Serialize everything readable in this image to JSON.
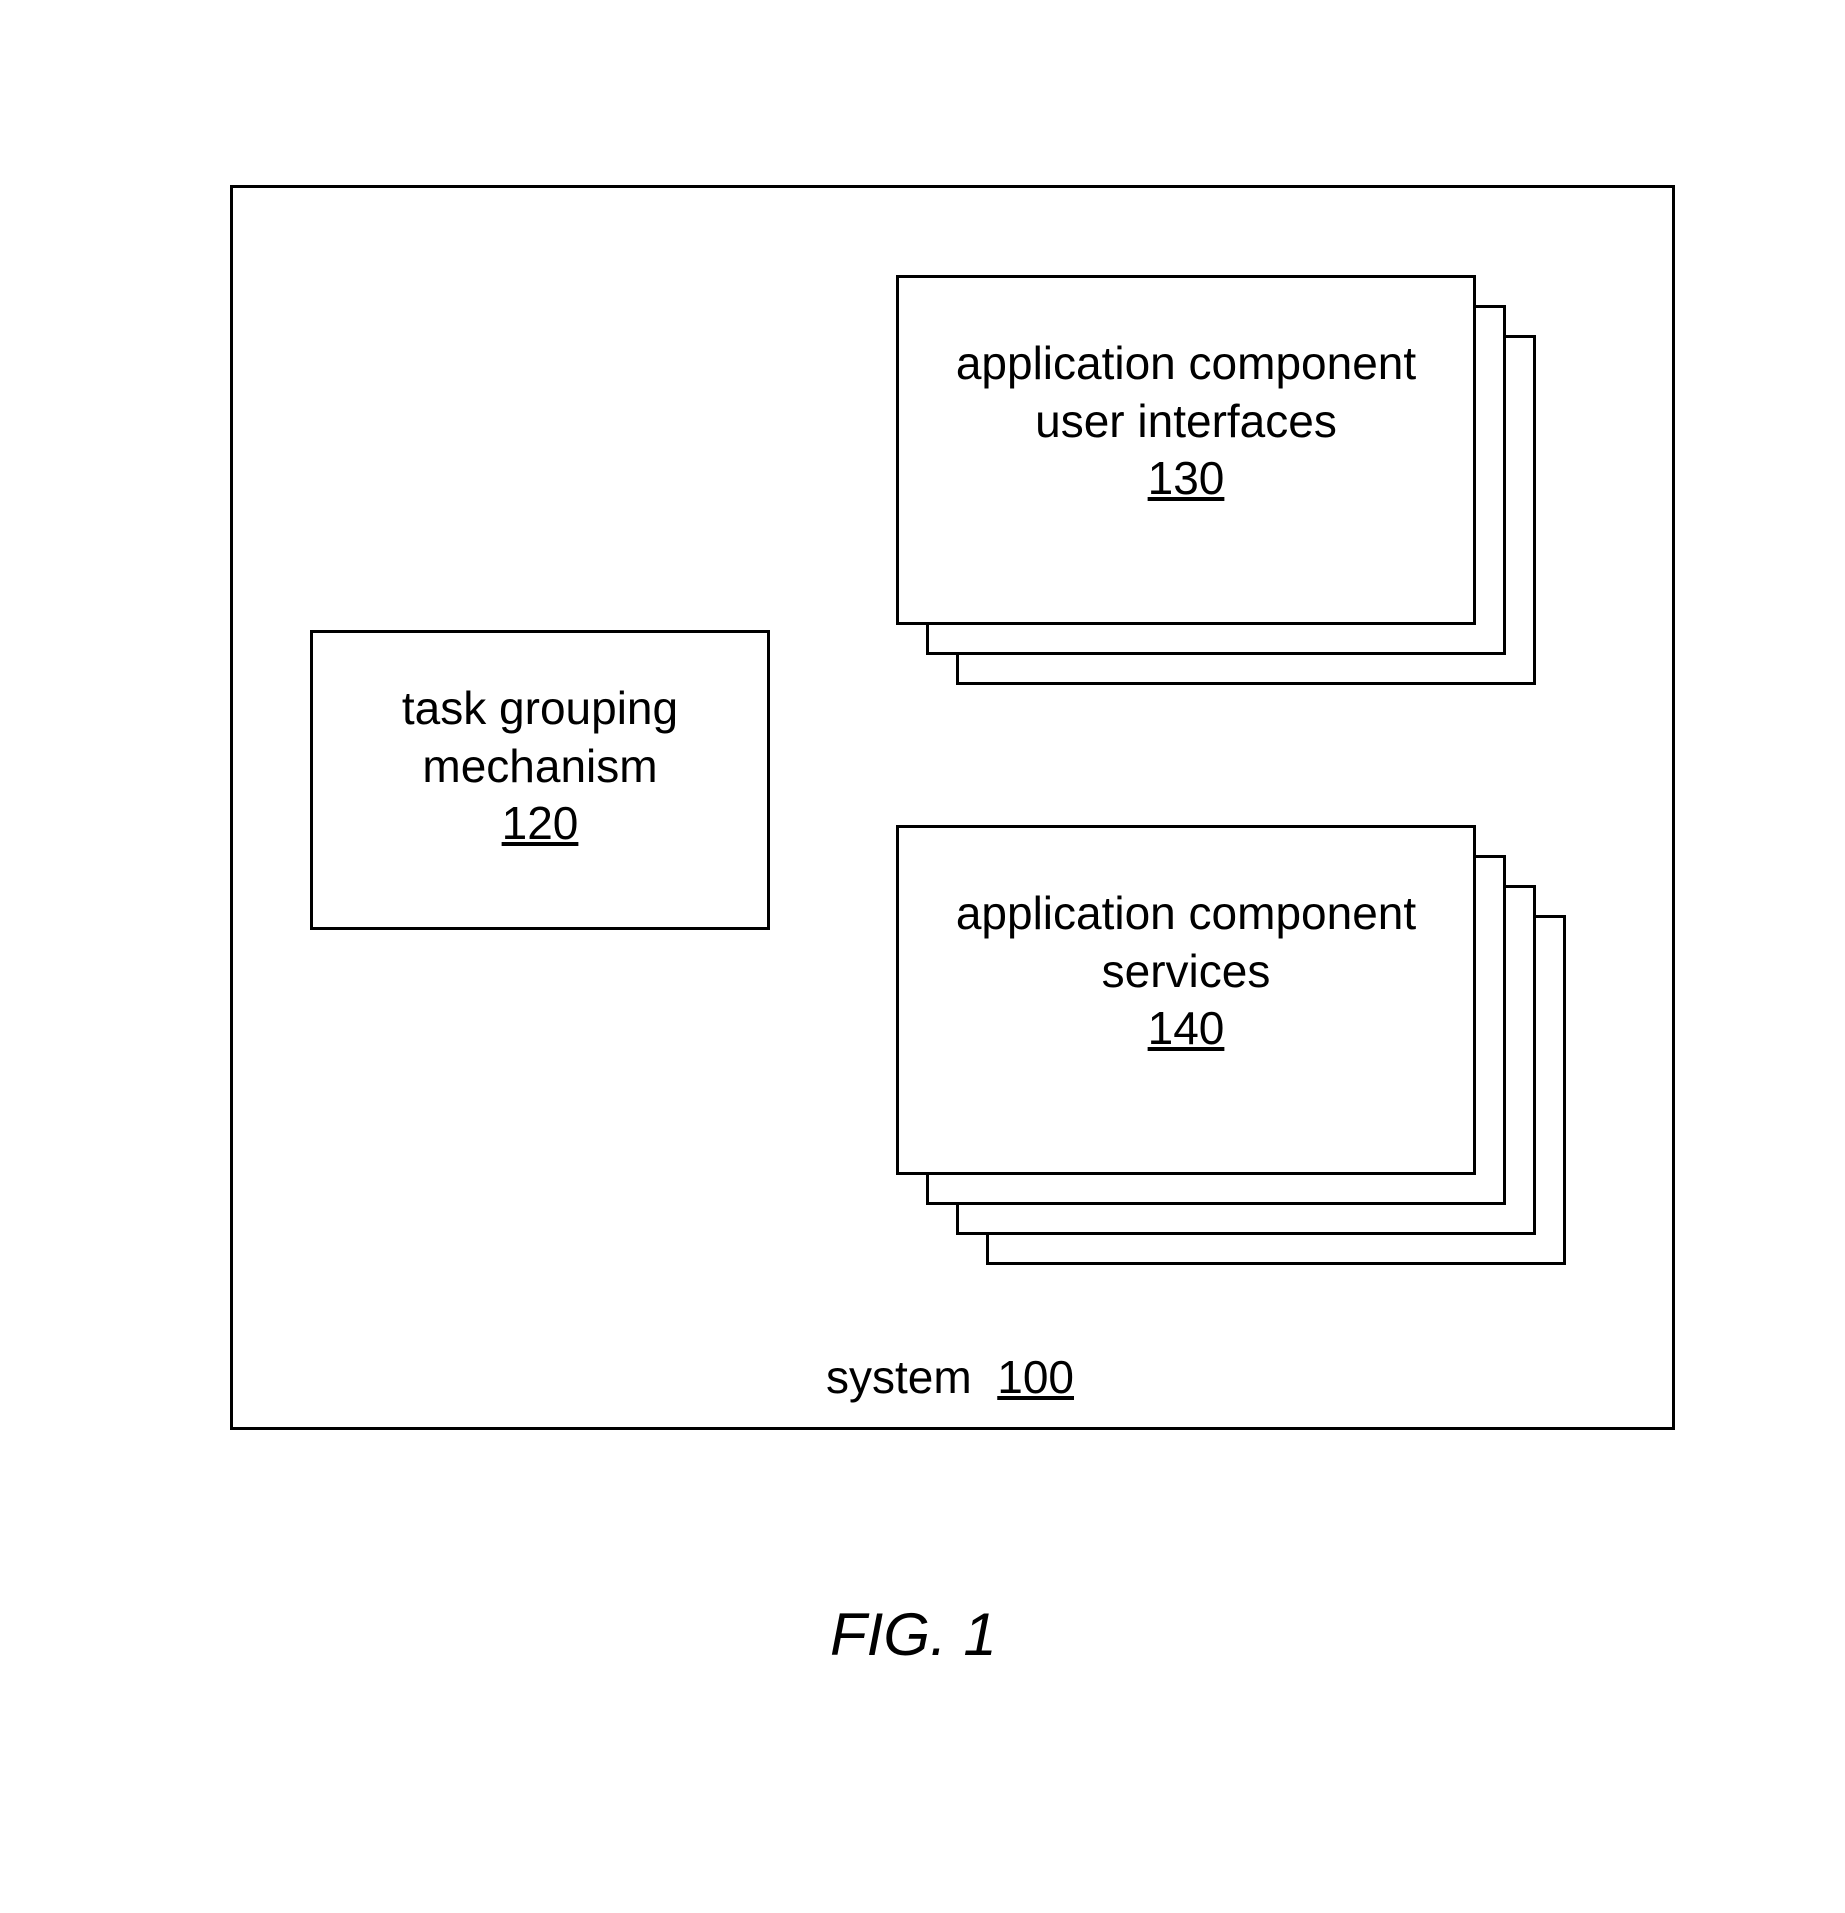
{
  "figure_caption": "FIG. 1",
  "system": {
    "label_prefix": "system",
    "number": "100"
  },
  "task_grouping": {
    "line1": "task grouping",
    "line2": "mechanism",
    "number": "120"
  },
  "ui_stack": {
    "line1": "application component",
    "line2": "user interfaces",
    "number": "130"
  },
  "services_stack": {
    "line1": "application component",
    "line2": "services",
    "number": "140"
  }
}
